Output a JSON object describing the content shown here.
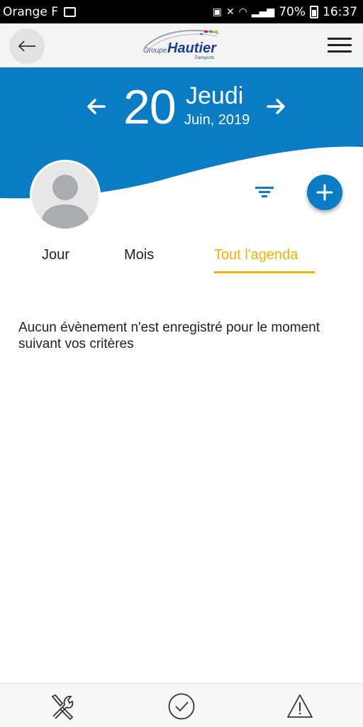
{
  "status_bar": {
    "carrier": "Orange F",
    "battery": "70%",
    "time": "16:37"
  },
  "header": {
    "logo_text_group": "Groupe",
    "logo_text_brand": "Hautier",
    "logo_text_sub": "Transports"
  },
  "date": {
    "day_number": "20",
    "day_name": "Jeudi",
    "month_year": "Juin, 2019"
  },
  "tabs": [
    {
      "label": "Jour",
      "active": false
    },
    {
      "label": "Mois",
      "active": false
    },
    {
      "label": "Tout l'agenda",
      "active": true
    }
  ],
  "empty_message": "Aucun évènement n'est enregistré pour le moment suivant vos critères",
  "colors": {
    "primary_blue": "#0a7cc3",
    "accent_yellow": "#f0b400",
    "header_bg": "#f4f4f4"
  },
  "bottom_nav": {
    "items": [
      "tools-icon",
      "check-circle-icon",
      "warning-icon"
    ]
  }
}
